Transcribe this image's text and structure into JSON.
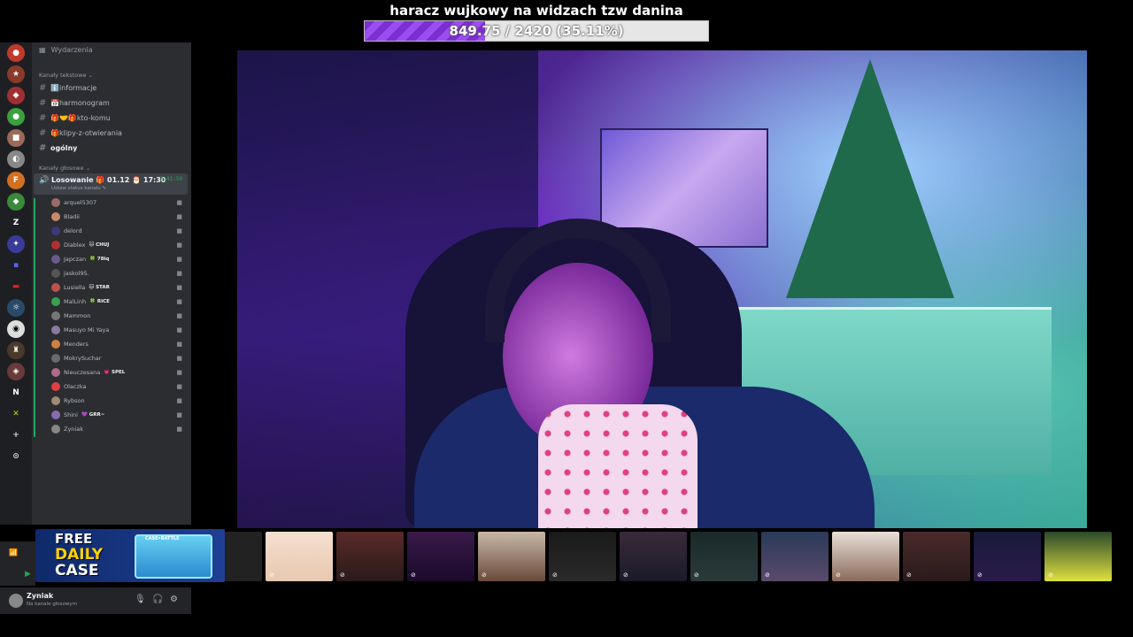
{
  "goal": {
    "title": "haracz wujkowy na widzach tzw danina",
    "progress_text": "849.75 / 2420 (35.11%)",
    "current": 849.75,
    "target": 2420,
    "percent": 35.11,
    "fill_color": "#8a3ee6"
  },
  "sidebar": {
    "events_label": "Wydarzenia",
    "text_category": "Kanały tekstowe ⌄",
    "text_channels": [
      {
        "label": "ℹ️informacje"
      },
      {
        "label": "📅harmonogram"
      },
      {
        "label": "🎁🤝🎁kto-komu"
      },
      {
        "label": "🎁klipy-z-otwierania"
      },
      {
        "label": "ogólny"
      }
    ],
    "voice_category": "Kanały głosowe ⌄",
    "voice_channel": {
      "name": "Losowanie 🎁 01.12 🎅 17:30",
      "timer": "3:41:59",
      "status": "Ustaw status kanału ✎"
    },
    "members": [
      {
        "name": "arquel5307",
        "tag": "",
        "color": "#9b6b6b"
      },
      {
        "name": "Bladii",
        "tag": "",
        "color": "#c48a6a"
      },
      {
        "name": "delord",
        "tag": "",
        "color": "#3a3a7a"
      },
      {
        "name": "Diablex",
        "tag": "🐱 CHUJ",
        "color": "#b03030"
      },
      {
        "name": "Japczan",
        "tag": "🍀 78iq",
        "color": "#6a5a8a"
      },
      {
        "name": "jaskol95.",
        "tag": "",
        "color": "#555"
      },
      {
        "name": "Lusiella",
        "tag": "🐱 STAR",
        "color": "#c05050"
      },
      {
        "name": "MalLinh",
        "tag": "🍀 RICE",
        "color": "#3aa050"
      },
      {
        "name": "Mammon",
        "tag": "",
        "color": "#777"
      },
      {
        "name": "Masuyo Mi Yaya",
        "tag": "",
        "color": "#8a7aa0"
      },
      {
        "name": "Menders",
        "tag": "",
        "color": "#d08040"
      },
      {
        "name": "MokrySuchar",
        "tag": "",
        "color": "#6a6a6a"
      },
      {
        "name": "Nieuczesana",
        "tag": "💗 SPEL",
        "color": "#b06a8a"
      },
      {
        "name": "Olaczka",
        "tag": "",
        "color": "#e04040"
      },
      {
        "name": "Rybson",
        "tag": "",
        "color": "#a08a70"
      },
      {
        "name": "Shini",
        "tag": "💜 GRR~",
        "color": "#8a6ab0"
      },
      {
        "name": "Zyniak",
        "tag": "",
        "color": "#888"
      }
    ]
  },
  "user_panel": {
    "name": "Zyniak",
    "status": "Na kanale głosowym"
  },
  "promo": {
    "line1": "FREE",
    "line2": "DAILY",
    "line3": "CASE",
    "case_label": "CASE•BATTLE"
  },
  "icons": {
    "mic": "mic-icon",
    "headphones": "headphones-icon",
    "settings": "gear-icon"
  }
}
